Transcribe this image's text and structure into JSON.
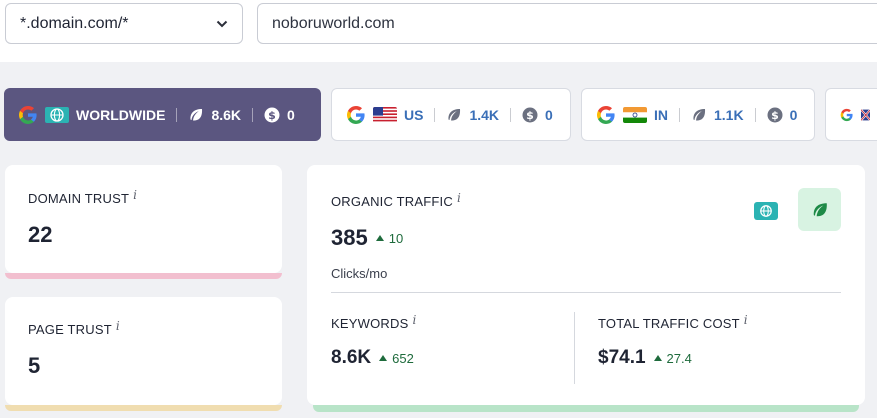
{
  "filter": {
    "scope_value": "*.domain.com/*",
    "domain_value": "noboruworld.com"
  },
  "databases": [
    {
      "flag_icon": "globe-icon",
      "label": "WORLDWIDE",
      "keywords": "8.6K",
      "cost": "0"
    },
    {
      "flag_icon": "us-flag-icon",
      "label": "US",
      "keywords": "1.4K",
      "cost": "0"
    },
    {
      "flag_icon": "in-flag-icon",
      "label": "IN",
      "keywords": "1.1K",
      "cost": "0"
    }
  ],
  "domain_trust": {
    "label": "DOMAIN TRUST",
    "info": "i",
    "value": "22"
  },
  "page_trust": {
    "label": "PAGE TRUST",
    "info": "i",
    "value": "5"
  },
  "organic": {
    "label": "ORGANIC TRAFFIC",
    "info": "i",
    "value": "385",
    "delta": "10",
    "unit": "Clicks/mo",
    "keywords_label": "KEYWORDS",
    "keywords_value": "8.6K",
    "keywords_delta": "652",
    "cost_label": "TOTAL TRAFFIC COST",
    "cost_value": "$74.1",
    "cost_delta": "27.4"
  },
  "colors": {
    "active_tab": "#5b5680",
    "domain_trust_bar": "#f2bfcf",
    "page_trust_bar": "#f0ddb0",
    "organic_bar": "#b8e4c8",
    "delta_up": "#1e6b3c",
    "globe_badge": "#2bb3b3"
  }
}
